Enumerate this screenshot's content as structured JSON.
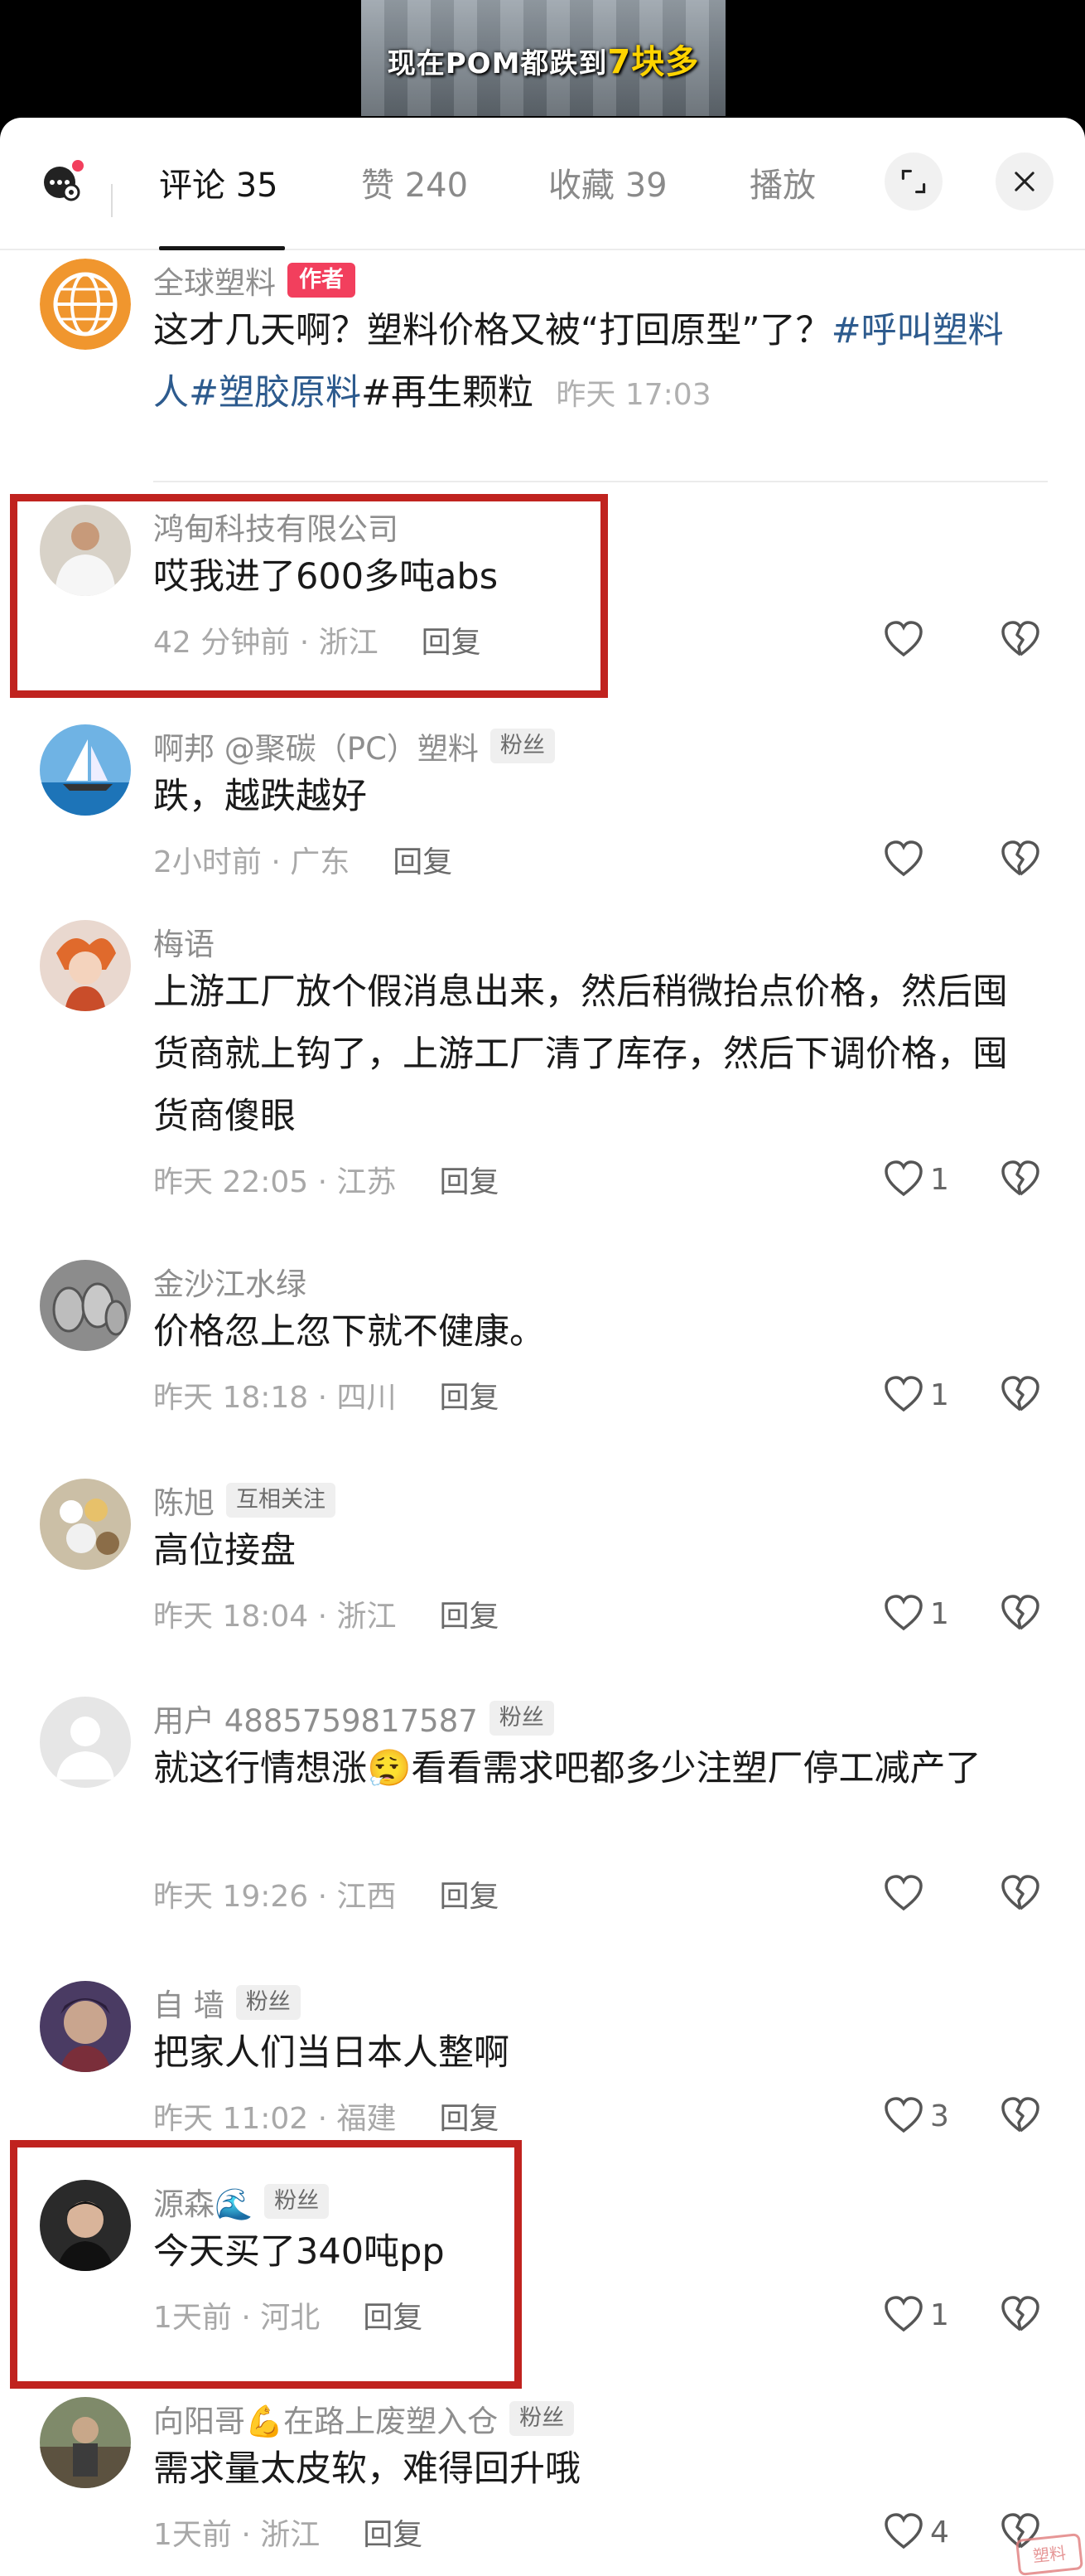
{
  "video": {
    "caption_prefix": "现在POM都跌到",
    "caption_highlight": "7块多"
  },
  "tabs": [
    {
      "label": "评论 35"
    },
    {
      "label": "赞 240"
    },
    {
      "label": "收藏 39"
    },
    {
      "label": "播放"
    }
  ],
  "author_post": {
    "name": "全球塑料",
    "badge": "作者",
    "text_main": "这才几天啊？塑料价格又被“打回原型”了？",
    "tag1": "#呼叫塑料人",
    "tag2": "#塑胶原料",
    "text_tail": "#再生颗粒",
    "time": "昨天 17:03"
  },
  "comments": [
    {
      "name": "鸿甸科技有限公司",
      "badge": "",
      "text": "哎我进了600多吨abs",
      "time": "42 分钟前 · 浙江",
      "reply": "回复",
      "likes": ""
    },
    {
      "name": "啊邦 @聚碳（PC）塑料",
      "badge": "粉丝",
      "text": "跌，越跌越好",
      "time": "2小时前 · 广东",
      "reply": "回复",
      "likes": ""
    },
    {
      "name": "梅语",
      "badge": "",
      "text": "上游工厂放个假消息出来，然后稍微抬点价格，然后囤货商就上钩了，上游工厂清了库存，然后下调价格，囤货商傻眼",
      "time": "昨天 22:05 · 江苏",
      "reply": "回复",
      "likes": "1"
    },
    {
      "name": "金沙江水绿",
      "badge": "",
      "text": "价格忽上忽下就不健康。",
      "time": "昨天 18:18 · 四川",
      "reply": "回复",
      "likes": "1"
    },
    {
      "name": "陈旭",
      "badge": "互相关注",
      "text": "高位接盘",
      "time": "昨天 18:04 · 浙江",
      "reply": "回复",
      "likes": "1"
    },
    {
      "name": "用户 4885759817587",
      "badge": "粉丝",
      "text": "就这行情想涨😮‍💨看看需求吧都多少注塑厂停工减产了",
      "time": "昨天 19:26 · 江西",
      "reply": "回复",
      "likes": ""
    },
    {
      "name": "自 墙",
      "badge": "粉丝",
      "text": "把家人们当日本人整啊",
      "time": "昨天 11:02 · 福建",
      "reply": "回复",
      "likes": "3"
    },
    {
      "name": "源森🌊",
      "badge": "粉丝",
      "text": "今天买了340吨pp",
      "time": "1天前 · 河北",
      "reply": "回复",
      "likes": "1"
    },
    {
      "name": "向阳哥💪在路上废塑入仓",
      "badge": "粉丝",
      "text": "需求量太皮软，难得回升哦",
      "time": "1天前 · 浙江",
      "reply": "回复",
      "likes": "4"
    }
  ],
  "watermark": "塑料"
}
